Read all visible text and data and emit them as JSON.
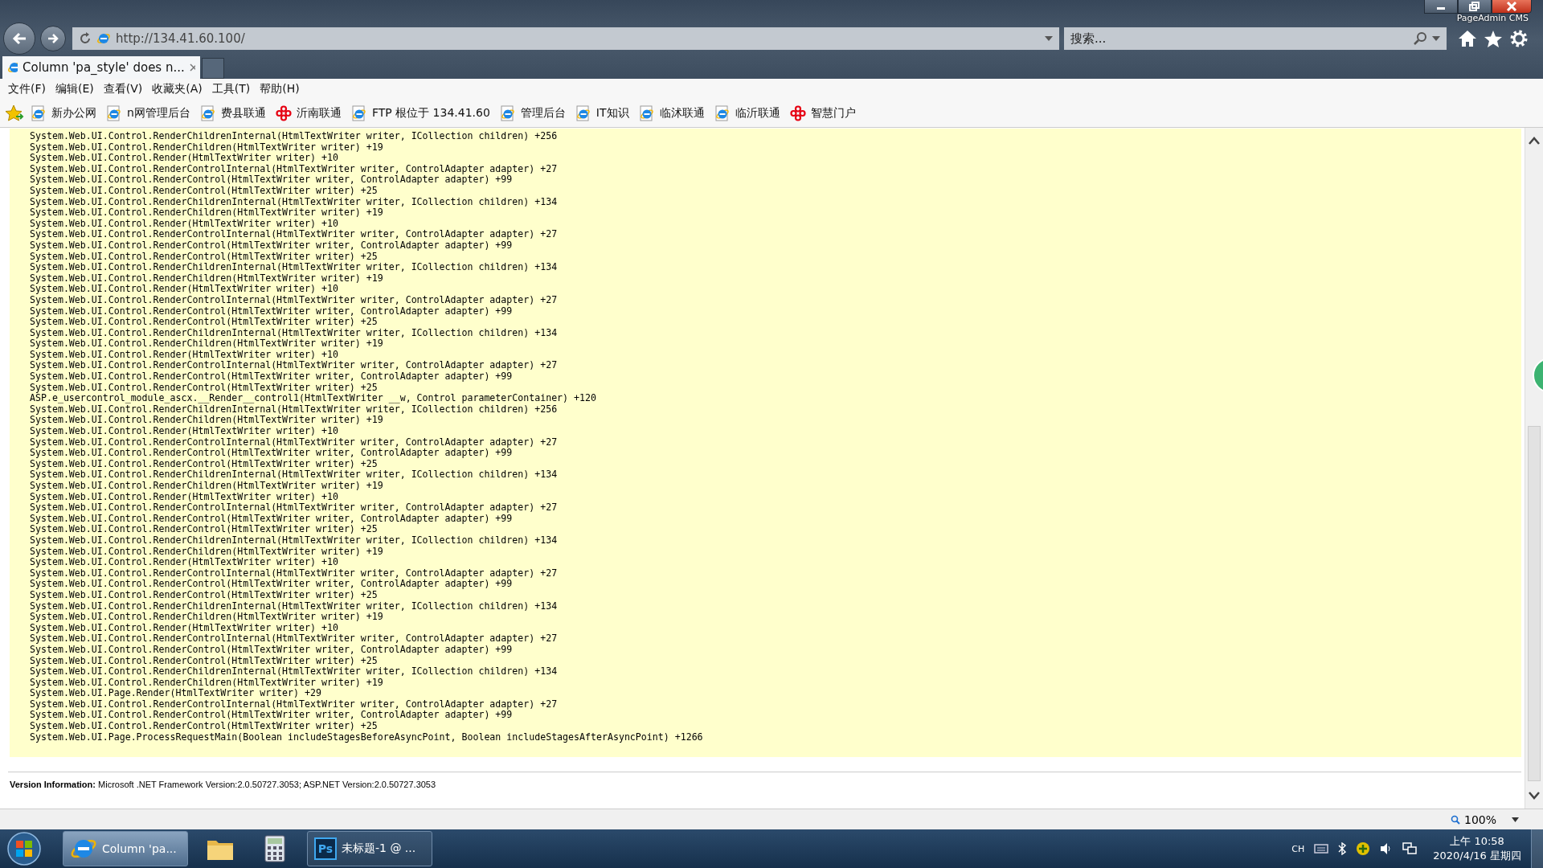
{
  "window": {
    "title": "PageAdmin CMS"
  },
  "address_bar": {
    "url": "http://134.41.60.100/"
  },
  "search": {
    "placeholder": "搜索..."
  },
  "tabs": [
    {
      "label": "Column 'pa_style' does n...",
      "selected": true
    }
  ],
  "menu": [
    "文件(F)",
    "编辑(E)",
    "查看(V)",
    "收藏夹(A)",
    "工具(T)",
    "帮助(H)"
  ],
  "favorites": [
    {
      "label": "新办公网",
      "kind": "ie"
    },
    {
      "label": "n网管理后台",
      "kind": "ie"
    },
    {
      "label": "费县联通",
      "kind": "ie"
    },
    {
      "label": "沂南联通",
      "kind": "knot"
    },
    {
      "label": "FTP 根位于 134.41.60",
      "kind": "ie"
    },
    {
      "label": "管理后台",
      "kind": "ie"
    },
    {
      "label": "IT知识",
      "kind": "ie"
    },
    {
      "label": "临沭联通",
      "kind": "ie"
    },
    {
      "label": "临沂联通",
      "kind": "ie"
    },
    {
      "label": "智慧门户",
      "kind": "knot"
    }
  ],
  "stack_trace": [
    "System.Web.UI.Control.RenderChildrenInternal(HtmlTextWriter writer, ICollection children) +256",
    "System.Web.UI.Control.RenderChildren(HtmlTextWriter writer) +19",
    "System.Web.UI.Control.Render(HtmlTextWriter writer) +10",
    "System.Web.UI.Control.RenderControlInternal(HtmlTextWriter writer, ControlAdapter adapter) +27",
    "System.Web.UI.Control.RenderControl(HtmlTextWriter writer, ControlAdapter adapter) +99",
    "System.Web.UI.Control.RenderControl(HtmlTextWriter writer) +25",
    "System.Web.UI.Control.RenderChildrenInternal(HtmlTextWriter writer, ICollection children) +134",
    "System.Web.UI.Control.RenderChildren(HtmlTextWriter writer) +19",
    "System.Web.UI.Control.Render(HtmlTextWriter writer) +10",
    "System.Web.UI.Control.RenderControlInternal(HtmlTextWriter writer, ControlAdapter adapter) +27",
    "System.Web.UI.Control.RenderControl(HtmlTextWriter writer, ControlAdapter adapter) +99",
    "System.Web.UI.Control.RenderControl(HtmlTextWriter writer) +25",
    "System.Web.UI.Control.RenderChildrenInternal(HtmlTextWriter writer, ICollection children) +134",
    "System.Web.UI.Control.RenderChildren(HtmlTextWriter writer) +19",
    "System.Web.UI.Control.Render(HtmlTextWriter writer) +10",
    "System.Web.UI.Control.RenderControlInternal(HtmlTextWriter writer, ControlAdapter adapter) +27",
    "System.Web.UI.Control.RenderControl(HtmlTextWriter writer, ControlAdapter adapter) +99",
    "System.Web.UI.Control.RenderControl(HtmlTextWriter writer) +25",
    "System.Web.UI.Control.RenderChildrenInternal(HtmlTextWriter writer, ICollection children) +134",
    "System.Web.UI.Control.RenderChildren(HtmlTextWriter writer) +19",
    "System.Web.UI.Control.Render(HtmlTextWriter writer) +10",
    "System.Web.UI.Control.RenderControlInternal(HtmlTextWriter writer, ControlAdapter adapter) +27",
    "System.Web.UI.Control.RenderControl(HtmlTextWriter writer, ControlAdapter adapter) +99",
    "System.Web.UI.Control.RenderControl(HtmlTextWriter writer) +25",
    "ASP.e_usercontrol_module_ascx.__Render__control1(HtmlTextWriter __w, Control parameterContainer) +120",
    "System.Web.UI.Control.RenderChildrenInternal(HtmlTextWriter writer, ICollection children) +256",
    "System.Web.UI.Control.RenderChildren(HtmlTextWriter writer) +19",
    "System.Web.UI.Control.Render(HtmlTextWriter writer) +10",
    "System.Web.UI.Control.RenderControlInternal(HtmlTextWriter writer, ControlAdapter adapter) +27",
    "System.Web.UI.Control.RenderControl(HtmlTextWriter writer, ControlAdapter adapter) +99",
    "System.Web.UI.Control.RenderControl(HtmlTextWriter writer) +25",
    "System.Web.UI.Control.RenderChildrenInternal(HtmlTextWriter writer, ICollection children) +134",
    "System.Web.UI.Control.RenderChildren(HtmlTextWriter writer) +19",
    "System.Web.UI.Control.Render(HtmlTextWriter writer) +10",
    "System.Web.UI.Control.RenderControlInternal(HtmlTextWriter writer, ControlAdapter adapter) +27",
    "System.Web.UI.Control.RenderControl(HtmlTextWriter writer, ControlAdapter adapter) +99",
    "System.Web.UI.Control.RenderControl(HtmlTextWriter writer) +25",
    "System.Web.UI.Control.RenderChildrenInternal(HtmlTextWriter writer, ICollection children) +134",
    "System.Web.UI.Control.RenderChildren(HtmlTextWriter writer) +19",
    "System.Web.UI.Control.Render(HtmlTextWriter writer) +10",
    "System.Web.UI.Control.RenderControlInternal(HtmlTextWriter writer, ControlAdapter adapter) +27",
    "System.Web.UI.Control.RenderControl(HtmlTextWriter writer, ControlAdapter adapter) +99",
    "System.Web.UI.Control.RenderControl(HtmlTextWriter writer) +25",
    "System.Web.UI.Control.RenderChildrenInternal(HtmlTextWriter writer, ICollection children) +134",
    "System.Web.UI.Control.RenderChildren(HtmlTextWriter writer) +19",
    "System.Web.UI.Control.Render(HtmlTextWriter writer) +10",
    "System.Web.UI.Control.RenderControlInternal(HtmlTextWriter writer, ControlAdapter adapter) +27",
    "System.Web.UI.Control.RenderControl(HtmlTextWriter writer, ControlAdapter adapter) +99",
    "System.Web.UI.Control.RenderControl(HtmlTextWriter writer) +25",
    "System.Web.UI.Control.RenderChildrenInternal(HtmlTextWriter writer, ICollection children) +134",
    "System.Web.UI.Control.RenderChildren(HtmlTextWriter writer) +19",
    "System.Web.UI.Page.Render(HtmlTextWriter writer) +29",
    "System.Web.UI.Control.RenderControlInternal(HtmlTextWriter writer, ControlAdapter adapter) +27",
    "System.Web.UI.Control.RenderControl(HtmlTextWriter writer, ControlAdapter adapter) +99",
    "System.Web.UI.Control.RenderControl(HtmlTextWriter writer) +25",
    "System.Web.UI.Page.ProcessRequestMain(Boolean includeStagesBeforeAsyncPoint, Boolean includeStagesAfterAsyncPoint) +1266"
  ],
  "version_info": {
    "label": "Version Information:",
    "text": "Microsoft .NET Framework Version:2.0.50727.3053; ASP.NET Version:2.0.50727.3053"
  },
  "status_bar": {
    "zoom": "100%"
  },
  "taskbar": {
    "items": [
      {
        "kind": "ie",
        "label": "Column 'pa...",
        "selected": true
      },
      {
        "kind": "folder",
        "selected": false
      },
      {
        "kind": "calculator",
        "selected": false
      },
      {
        "kind": "ps",
        "icon_text": "Ps",
        "label": "未标题-1 @ ...",
        "selected": false
      }
    ],
    "tray": {
      "language": "CH",
      "time": "上午 10:58",
      "date": "2020/4/16 星期四"
    }
  }
}
